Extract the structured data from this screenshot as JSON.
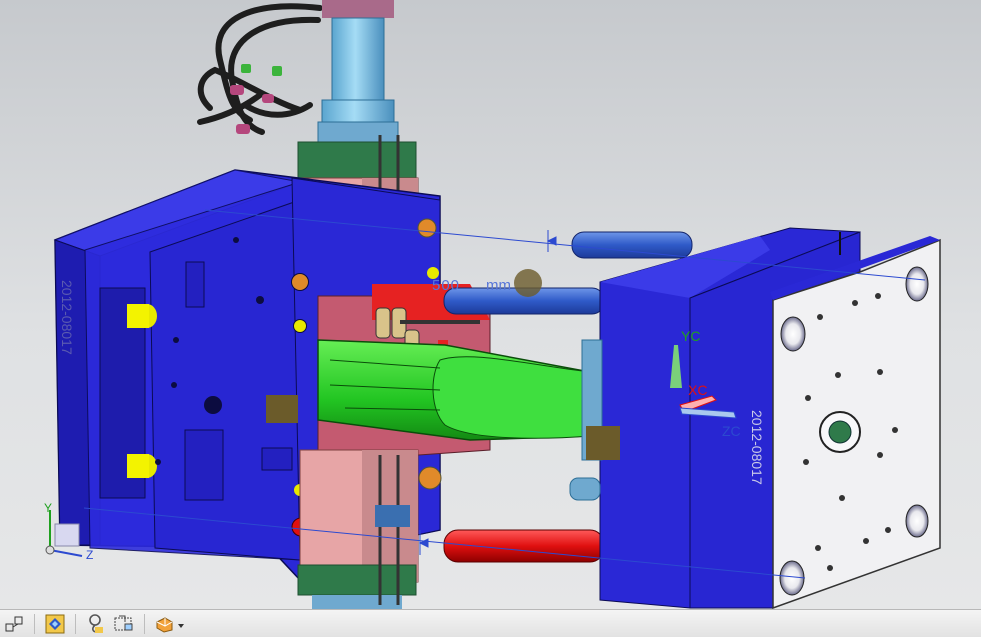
{
  "viewport": {
    "name": "graphics-window",
    "dimension_text": "500",
    "dimension_unit": "mm",
    "wcs_labels": {
      "xc": "XC",
      "yc": "YC",
      "zc": "ZC"
    },
    "triad_labels": {
      "y": "Y",
      "z": "Z"
    },
    "engraved_text_left": "2012-08017",
    "engraved_text_right": "2012-08017",
    "colors": {
      "mold_plate": "#2a28d6",
      "plate_face": "#f1f1f3",
      "core_insert": "#c96f7c",
      "slider_green": "#2fcf2f",
      "cylinder_blue": "#76bde0",
      "tie_bar_blue": "#3a68d0",
      "tie_bar_red": "#e01010",
      "ejector_yellow": "#f3f300",
      "water_orange": "#e08a2a",
      "dim_line": "#2c4ad0"
    }
  },
  "toolbar": {
    "buttons": [
      {
        "name": "assembly-constraint-icon"
      },
      {
        "name": "component-view-icon"
      },
      {
        "name": "lasso-icon"
      },
      {
        "name": "orient-view-icon"
      },
      {
        "name": "render-style-dropdown-icon",
        "dropdown": true
      }
    ]
  }
}
